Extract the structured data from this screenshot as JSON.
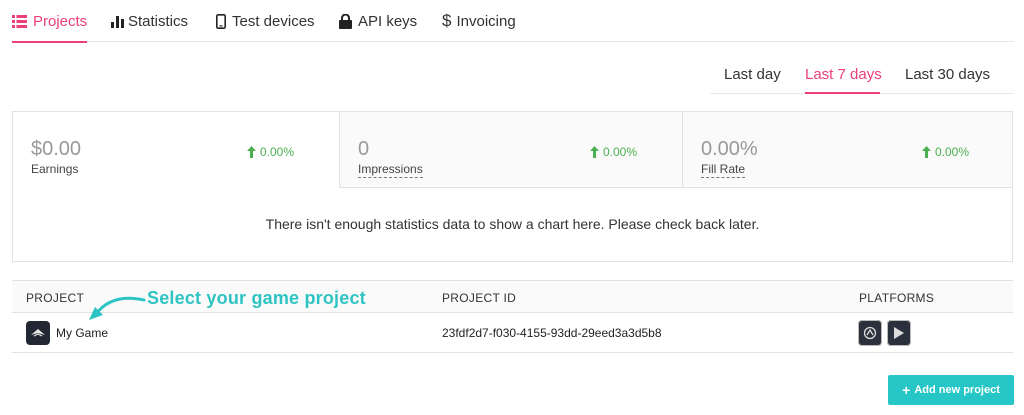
{
  "nav": {
    "items": [
      {
        "label": "Projects",
        "icon": "list-icon",
        "active": true
      },
      {
        "label": "Statistics",
        "icon": "bar-chart-icon",
        "active": false
      },
      {
        "label": "Test devices",
        "icon": "mobile-icon",
        "active": false
      },
      {
        "label": "API keys",
        "icon": "lock-icon",
        "active": false
      },
      {
        "label": "Invoicing",
        "icon": "dollar-icon",
        "active": false
      }
    ]
  },
  "range": {
    "tabs": [
      {
        "label": "Last day",
        "active": false
      },
      {
        "label": "Last 7 days",
        "active": true
      },
      {
        "label": "Last 30 days",
        "active": false
      }
    ]
  },
  "stats": {
    "cards": [
      {
        "value": "$0.00",
        "label": "Earnings",
        "change": "0.00%"
      },
      {
        "value": "0",
        "label": "Impressions",
        "change": "0.00%"
      },
      {
        "value": "0.00%",
        "label": "Fill Rate",
        "change": "0.00%"
      }
    ],
    "no_data_message": "There isn't enough statistics data to show a chart here. Please check back later."
  },
  "table": {
    "headers": {
      "project": "PROJECT",
      "project_id": "PROJECT ID",
      "platforms": "PLATFORMS"
    },
    "rows": [
      {
        "name": "My Game",
        "id": "23fdf2d7-f030-4155-93dd-29eed3a3d5b8",
        "platforms": [
          "ios-icon",
          "android-play-icon"
        ]
      }
    ]
  },
  "annotation": {
    "text": "Select your game project"
  },
  "actions": {
    "add_project_label": "Add new project"
  },
  "colors": {
    "accent": "#ec407a",
    "positive": "#4caf50",
    "teal": "#26c6c6"
  }
}
